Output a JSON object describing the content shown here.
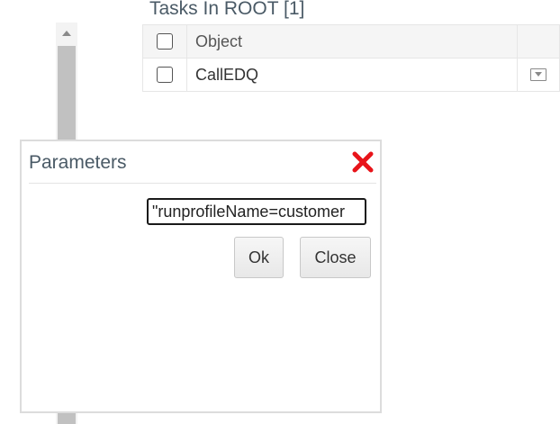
{
  "tasks": {
    "title": "Tasks In ROOT [1]",
    "columns": [
      "",
      "Object",
      ""
    ],
    "rows": [
      {
        "object": "CallEDQ"
      }
    ]
  },
  "dialog": {
    "title": "Parameters",
    "input_value": "\"runprofileName=customer",
    "ok_label": "Ok",
    "close_label": "Close"
  },
  "colors": {
    "close_icon": "#e8141a",
    "title_text": "#4a5a66"
  }
}
